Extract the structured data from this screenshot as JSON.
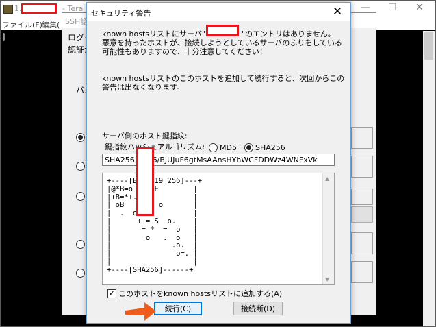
{
  "main_window": {
    "title_prefix": "1.",
    "title_suffix": "- Tera",
    "menu": [
      "ファイル(F)",
      "編集("
    ],
    "cursor": "]"
  },
  "ssh_dialog": {
    "title": "SSH認",
    "labels": [
      "ログイ",
      "認証が",
      "パス"
    ]
  },
  "security_dialog": {
    "title": "セキュリティ警告",
    "message_line1_a": "known hostsリストにサーバ\"",
    "message_line1_b": "\"のエントリはありません。",
    "message_line2": "悪意を持ったホストが、接続しようとしているサーバのふりをしている",
    "message_line3": "可能性もありますので、十分注意してください！",
    "message_line4": "known hostsリストのこのホストを追加して続行すると、次回からこの",
    "message_line5": "警告は出なくなります。",
    "fingerprint_label": "サーバ側のホスト鍵指紋:",
    "hash_algo_label": "鍵指紋ハッシュアルゴリズム:",
    "hash_options": [
      "MD5",
      "SHA256"
    ],
    "hash_selected": "SHA256",
    "fingerprint_value": "SHA256:                    +M6/BJUJuF6gtMsAAnsHYhWCFDDWz4WNFxVk",
    "randomart": "+----[ED25519 256]---+\n|@*B=o    +E        |\n|+B=*+.   .         |\n| oB   o.   o       |\n|  .  o  .          |\n|      + = S  o.    |\n|       = *  =  o   |\n|        o   .  o   |\n|              .o.  |\n|               o=. |\n|                   |\n+----[SHA256]------+",
    "add_checkbox_label": "このホストをknown hostsリストに追加する(A)",
    "add_checked": true,
    "continue_button": "続行(C)",
    "disconnect_button": "接続断(D)"
  },
  "colors": {
    "redaction": "#e8141e",
    "arrow": "#f05a1a",
    "default_button_border": "#0078d7"
  }
}
